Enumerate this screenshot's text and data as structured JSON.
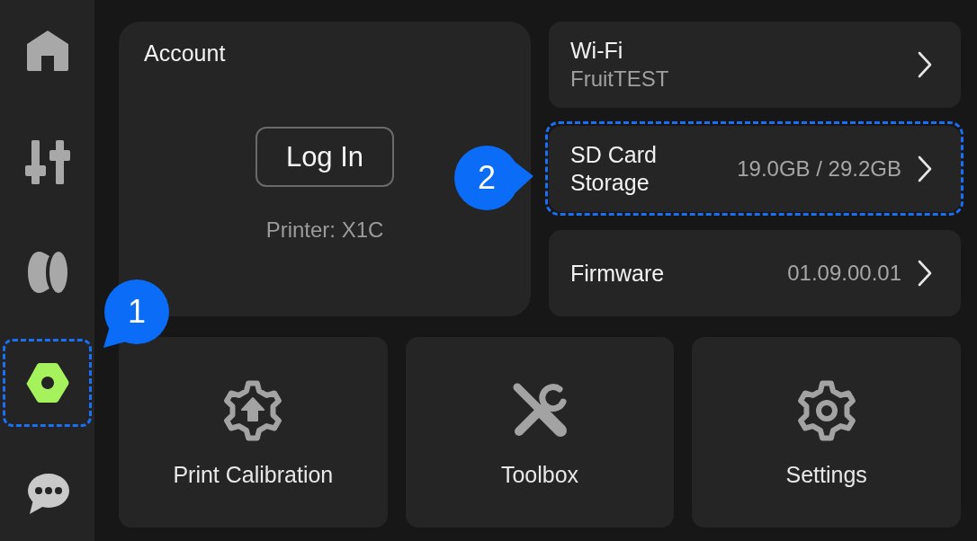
{
  "sidebar": {
    "items": [
      {
        "selected": false,
        "highlighted": false
      },
      {
        "selected": false,
        "highlighted": false
      },
      {
        "selected": false,
        "highlighted": false
      },
      {
        "selected": true,
        "highlighted": true,
        "callout": "1"
      },
      {
        "selected": false,
        "highlighted": false
      }
    ]
  },
  "account": {
    "title": "Account",
    "login_button": "Log In",
    "printer": "Printer: X1C"
  },
  "settings_rows": [
    {
      "title": "Wi-Fi",
      "subtitle": "FruitTEST",
      "highlighted": false
    },
    {
      "title": "SD Card Storage",
      "value": "19.0GB / 29.2GB",
      "highlighted": true,
      "callout": "2"
    },
    {
      "title": "Firmware",
      "value": "01.09.00.01",
      "highlighted": false
    }
  ],
  "tiles": [
    {
      "label": "Print Calibration"
    },
    {
      "label": "Toolbox"
    },
    {
      "label": "Settings"
    }
  ]
}
